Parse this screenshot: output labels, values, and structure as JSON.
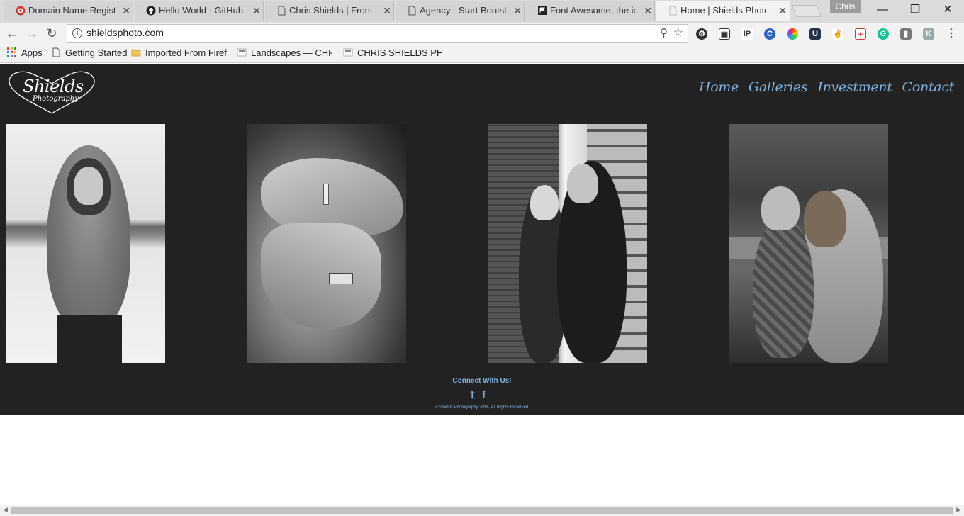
{
  "browser": {
    "tabs": [
      {
        "label": "Domain Name Registra",
        "icon": "registrar-icon"
      },
      {
        "label": "Hello World · GitHub G",
        "icon": "github-icon"
      },
      {
        "label": "Chris Shields | Front En",
        "icon": "page-icon"
      },
      {
        "label": "Agency - Start Bootstra",
        "icon": "page-icon"
      },
      {
        "label": "Font Awesome, the ico",
        "icon": "flag-icon"
      },
      {
        "label": "Home | Shields Photog",
        "icon": "page-icon"
      }
    ],
    "close_glyph": "✕",
    "profile_name": "Chris",
    "url": "shieldsphoto.com",
    "bookmarks": [
      {
        "label": "Apps",
        "icon": "apps-grid-icon"
      },
      {
        "label": "Getting Started",
        "icon": "page-icon"
      },
      {
        "label": "Imported From Firefo",
        "icon": "folder-icon"
      },
      {
        "label": "Landscapes — CHRIS",
        "icon": "site-icon"
      },
      {
        "label": "CHRIS SHIELDS PHOTO",
        "icon": "site-icon"
      }
    ]
  },
  "site": {
    "logo": {
      "title": "Shields",
      "subtitle": "Photography"
    },
    "nav": [
      "Home",
      "Galleries",
      "Investment",
      "Contact"
    ],
    "photos": [
      {
        "alt": "woman-in-snow"
      },
      {
        "alt": "hands-with-rings"
      },
      {
        "alt": "couple-by-brick-wall"
      },
      {
        "alt": "mother-and-child"
      }
    ],
    "footer": {
      "connect": "Connect With Us!",
      "copyright": "© Shields Photography 2016, All Rights Reserved."
    },
    "colors": {
      "background": "#222222",
      "accent": "#7fb2e0"
    }
  }
}
